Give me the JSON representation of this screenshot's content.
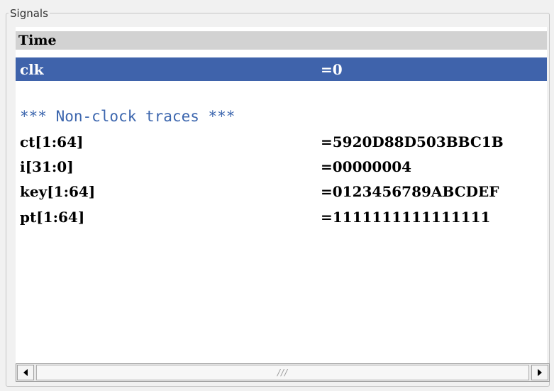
{
  "groupbox": {
    "title": "Signals"
  },
  "header": {
    "label": "Time"
  },
  "selected_row": {
    "name": "clk",
    "value": "=0"
  },
  "section": {
    "label": "*** Non-clock traces ***"
  },
  "signals": [
    {
      "name": "ct[1:64]",
      "value": "=5920D88D503BBC1B"
    },
    {
      "name": "i[31:0]",
      "value": "=00000004"
    },
    {
      "name": "key[1:64]",
      "value": "=0123456789ABCDEF"
    },
    {
      "name": "pt[1:64]",
      "value": "=1111111111111111"
    }
  ],
  "scrollbar": {
    "grip": "///"
  },
  "colors": {
    "selection": "#3f63ab",
    "section_text": "#3c66ae",
    "header_bg": "#d2d2d2"
  }
}
